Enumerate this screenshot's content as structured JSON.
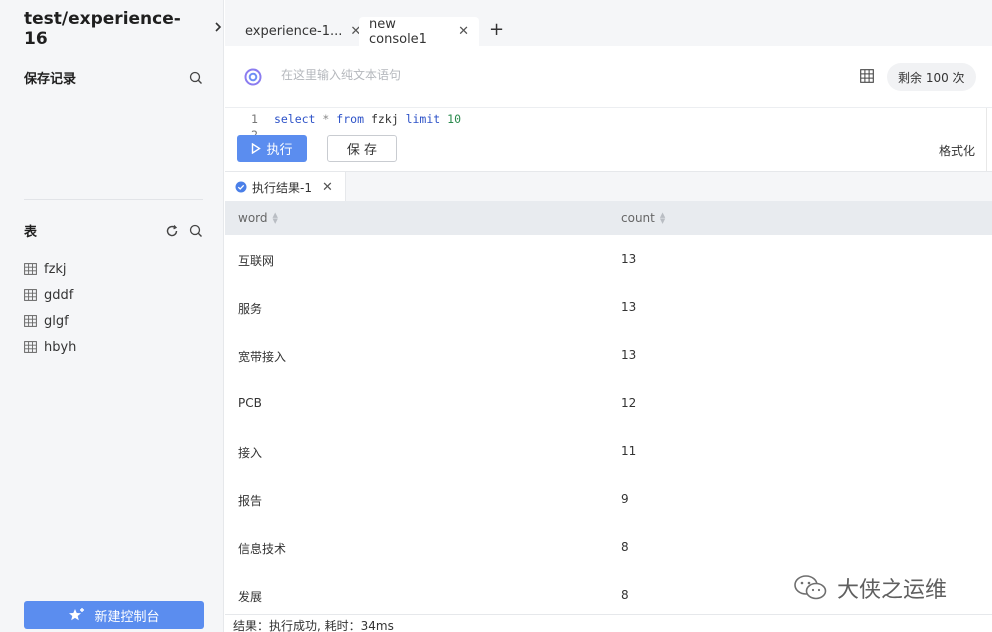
{
  "project": {
    "title": "test/experience-16"
  },
  "sidebar": {
    "saved_label": "保存记录",
    "tables_label": "表",
    "tables": [
      {
        "name": "fzkj"
      },
      {
        "name": "gddf"
      },
      {
        "name": "glgf"
      },
      {
        "name": "hbyh"
      }
    ],
    "new_console_label": "新建控制台"
  },
  "tabs": [
    {
      "label": "experience-1..."
    },
    {
      "label": "new console1"
    }
  ],
  "prompt": {
    "placeholder": "在这里输入纯文本语句",
    "remaining": "剩余 100 次"
  },
  "editor": {
    "line1_num": "1",
    "line2_num": "2",
    "code": {
      "t1": "select",
      "t2": "*",
      "t3": "from",
      "t4": "fzkj",
      "t5": "limit",
      "t6": "10"
    },
    "run_label": "执行",
    "save_label": "保 存",
    "format_label": "格式化"
  },
  "results": {
    "tab_label": "执行结果-1",
    "columns": [
      "word",
      "count"
    ],
    "rows": [
      {
        "word": "互联网",
        "count": "13"
      },
      {
        "word": "服务",
        "count": "13"
      },
      {
        "word": "宽带接入",
        "count": "13"
      },
      {
        "word": "PCB",
        "count": "12"
      },
      {
        "word": "接入",
        "count": "11"
      },
      {
        "word": "报告",
        "count": "9"
      },
      {
        "word": "信息技术",
        "count": "8"
      },
      {
        "word": "发展",
        "count": "8"
      }
    ],
    "status": "结果：执行成功, 耗时：34ms"
  },
  "watermark": {
    "text": "大侠之运维"
  },
  "colors": {
    "accent": "#5b8def",
    "sidebar_bg": "#f5f6f8"
  }
}
